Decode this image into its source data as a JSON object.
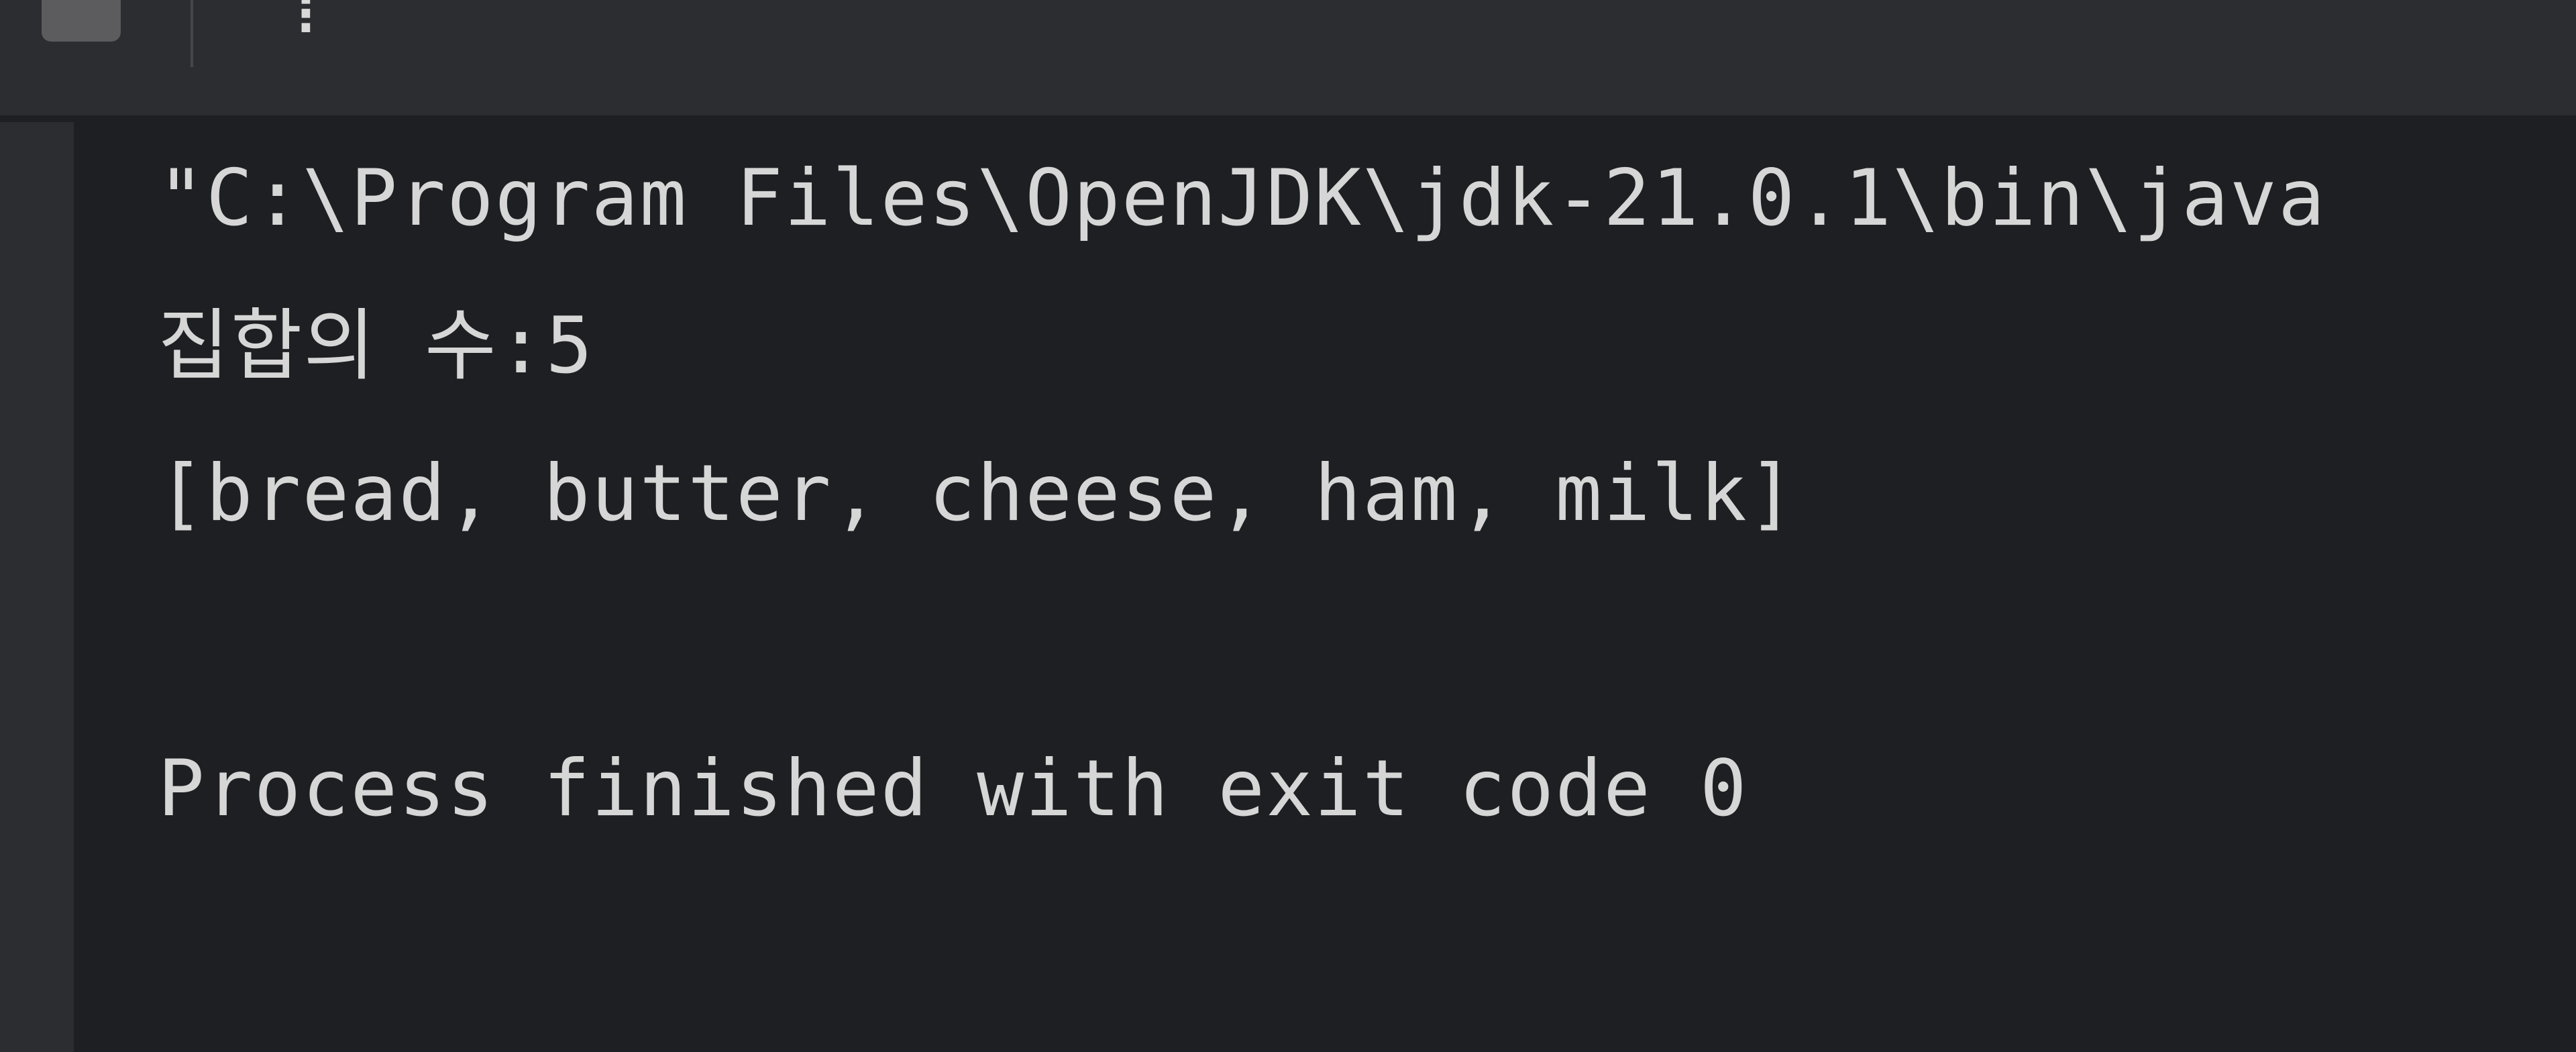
{
  "toolbar": {
    "stop_icon": "stop-icon",
    "more_icon": "more-vertical-icon",
    "more_glyph": "⋮"
  },
  "console": {
    "lines": [
      "\"C:\\Program Files\\OpenJDK\\jdk-21.0.1\\bin\\java",
      "집합의 수:5",
      "[bread, butter, cheese, ham, milk]",
      "",
      "Process finished with exit code 0"
    ]
  },
  "colors": {
    "toolbar_bg": "#2b2d30",
    "console_bg": "#1e1f22",
    "text": "#d6d6d6"
  }
}
